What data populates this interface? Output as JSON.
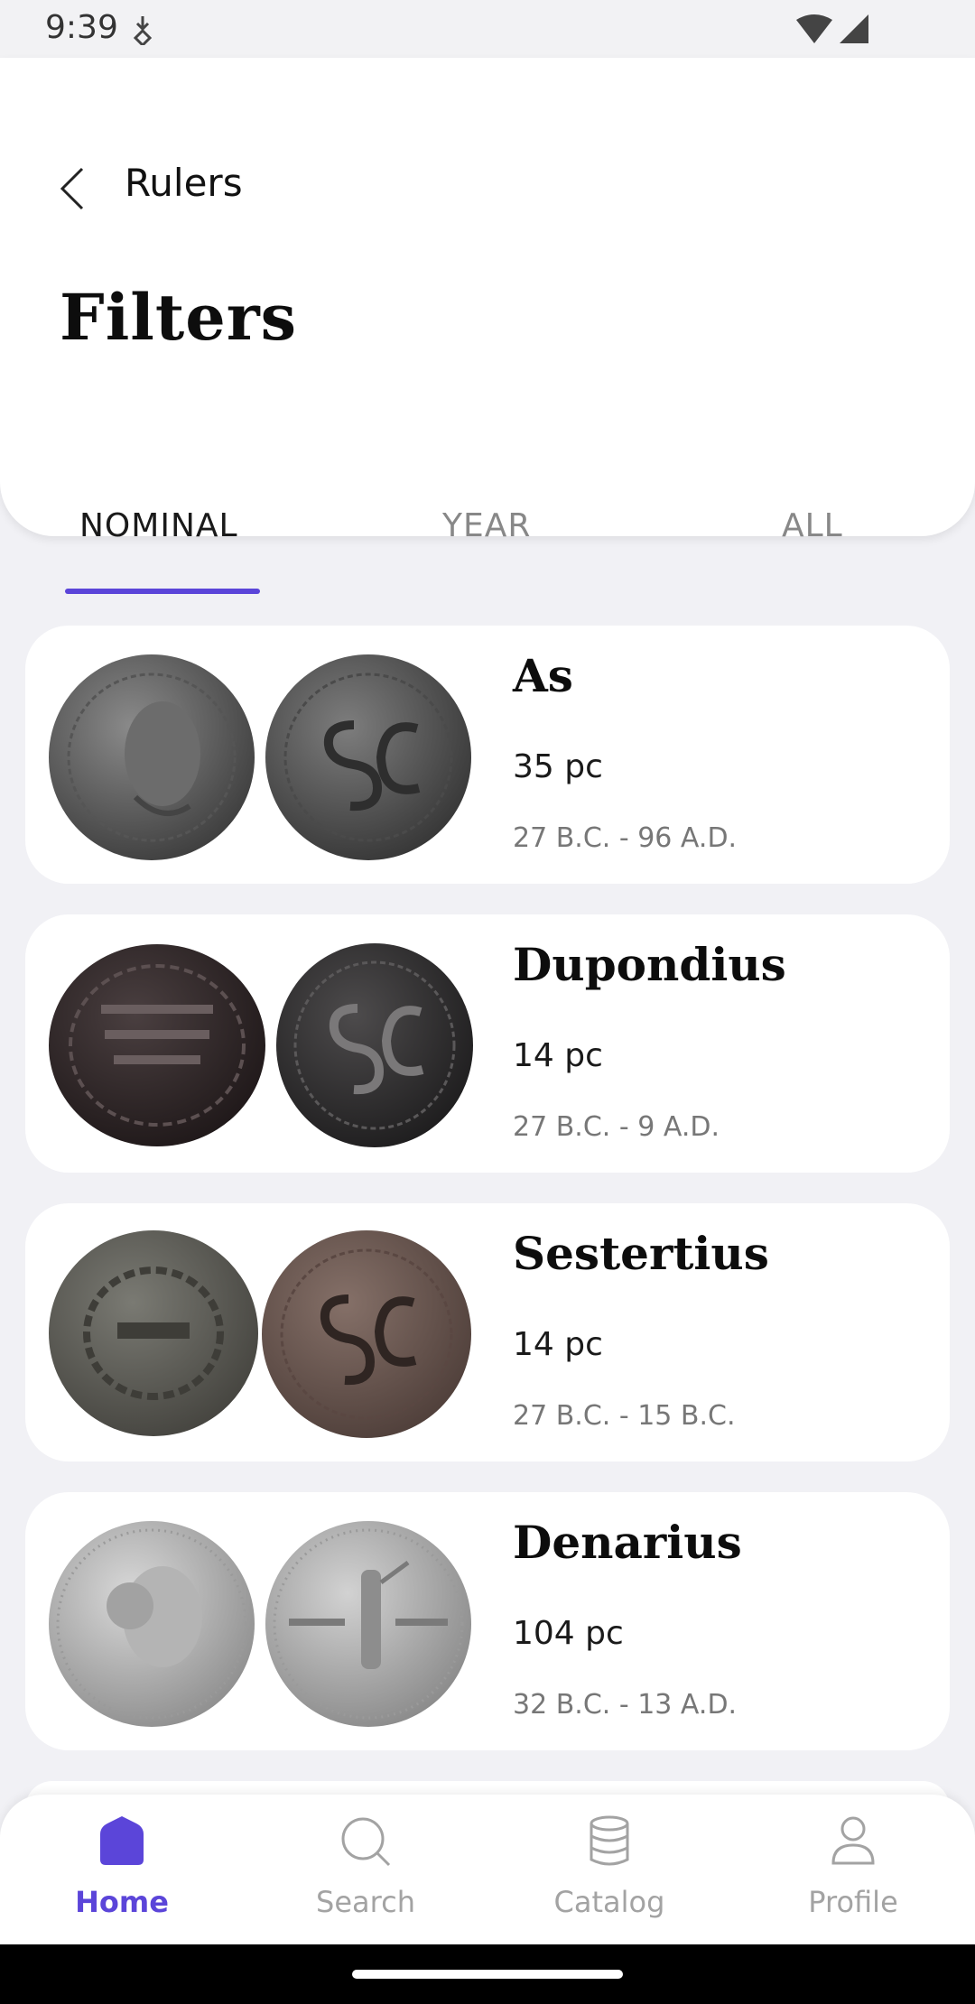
{
  "status": {
    "time": "9:39"
  },
  "header": {
    "back_label": "Rulers",
    "title": "Filters"
  },
  "tabs": [
    {
      "label": "NOMINAL",
      "active": true
    },
    {
      "label": "YEAR",
      "active": false
    },
    {
      "label": "ALL",
      "active": false
    }
  ],
  "items": [
    {
      "name": "As",
      "count": "35 pc",
      "years": "27 B.C. - 96 A.D."
    },
    {
      "name": "Dupondius",
      "count": "14 pc",
      "years": "27 B.C. - 9 A.D."
    },
    {
      "name": "Sestertius",
      "count": "14 pc",
      "years": "27 B.C. - 15 B.C."
    },
    {
      "name": "Denarius",
      "count": "104 pc",
      "years": "32 B.C. - 13 A.D."
    }
  ],
  "nav": [
    {
      "label": "Home",
      "icon": "home-icon",
      "active": true
    },
    {
      "label": "Search",
      "icon": "search-icon",
      "active": false
    },
    {
      "label": "Catalog",
      "icon": "database-icon",
      "active": false
    },
    {
      "label": "Profile",
      "icon": "person-icon",
      "active": false
    }
  ],
  "colors": {
    "accent": "#5b45d9",
    "background": "#f1f1f5"
  }
}
